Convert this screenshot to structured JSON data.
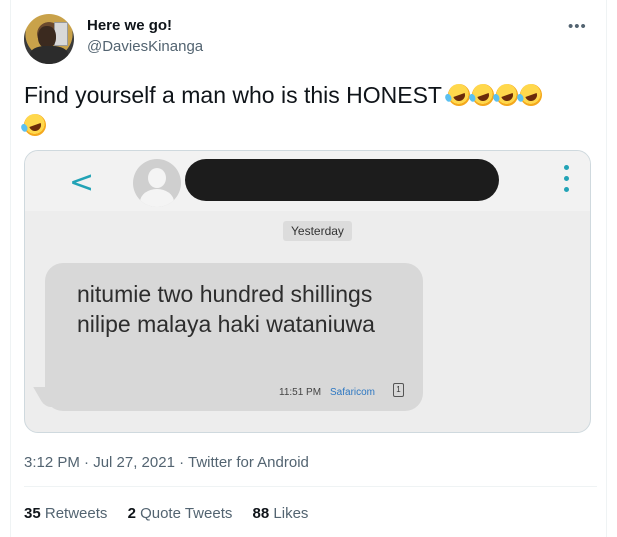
{
  "user": {
    "display_name": "Here we go!",
    "handle": "@DaviesKinanga"
  },
  "more_icon": "more-horizontal-icon",
  "tweet": {
    "text": "Find yourself a man who is this HONEST",
    "emoji_name": "rolling-on-the-floor-laughing",
    "emoji_count": 5
  },
  "media": {
    "date_label": "Yesterday",
    "message": "nitumie two hundred shillings nilipe malaya haki wataniuwa",
    "time": "11:51 PM",
    "carrier": "Safaricom",
    "sim_label": "1",
    "accent_color": "#22a3b6"
  },
  "meta": {
    "timestamp": "3:12 PM · Jul 27, 2021 · Twitter for Android"
  },
  "stats": {
    "retweets_count": "35",
    "retweets_label": "Retweets",
    "quotes_count": "2",
    "quotes_label": "Quote Tweets",
    "likes_count": "88",
    "likes_label": "Likes"
  }
}
